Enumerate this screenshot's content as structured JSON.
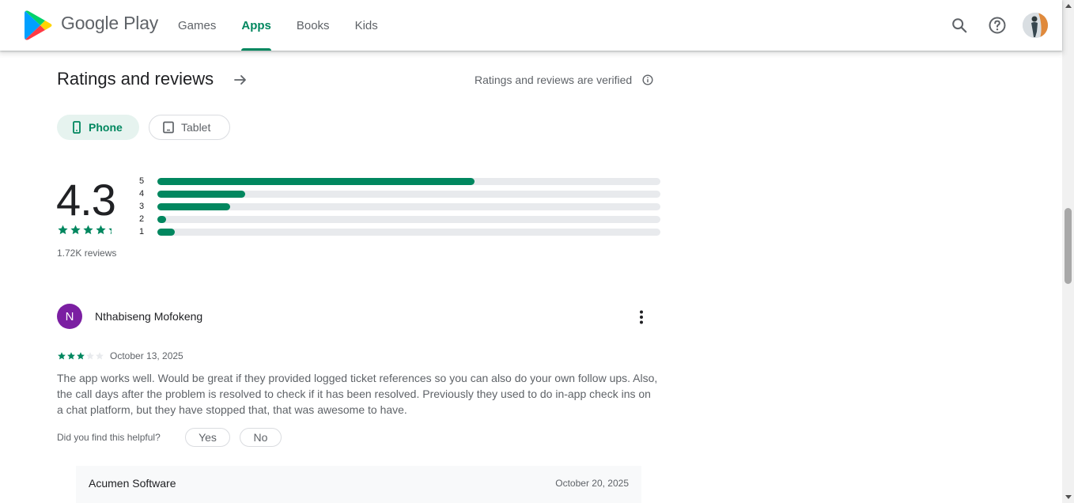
{
  "header": {
    "brand": "Google Play",
    "nav": [
      {
        "label": "Games",
        "active": false
      },
      {
        "label": "Apps",
        "active": true
      },
      {
        "label": "Books",
        "active": false
      },
      {
        "label": "Kids",
        "active": false
      }
    ],
    "icons": [
      "search-icon",
      "help-icon",
      "account-avatar"
    ],
    "accent_color": "#01875f"
  },
  "ratings": {
    "title": "Ratings and reviews",
    "verified_text": "Ratings and reviews are verified",
    "device_tabs": [
      {
        "label": "Phone",
        "selected": true
      },
      {
        "label": "Tablet",
        "selected": false
      }
    ],
    "average": "4.3",
    "average_stars": 4.3,
    "count_text": "1.72K reviews",
    "distribution": [
      {
        "label": "5",
        "fraction": 0.63
      },
      {
        "label": "4",
        "fraction": 0.175
      },
      {
        "label": "3",
        "fraction": 0.145
      },
      {
        "label": "2",
        "fraction": 0.017
      },
      {
        "label": "1",
        "fraction": 0.035
      }
    ]
  },
  "review": {
    "author_initial": "N",
    "author_name": "Nthabiseng Mofokeng",
    "avatar_color": "#7b1fa2",
    "stars": 3,
    "date": "October 13, 2025",
    "text": "The app works well. Would be great if they provided logged ticket references so you can also do your own follow ups. Also, the call days after the problem is resolved to check if it has been resolved. Previously they used to do in-app check ins on a chat platform, but they have stopped that, that was awesome to have.",
    "helpful_prompt": "Did you find this helpful?",
    "yes_label": "Yes",
    "no_label": "No",
    "developer_reply": {
      "name": "Acumen Software",
      "date": "October 20, 2025"
    }
  }
}
